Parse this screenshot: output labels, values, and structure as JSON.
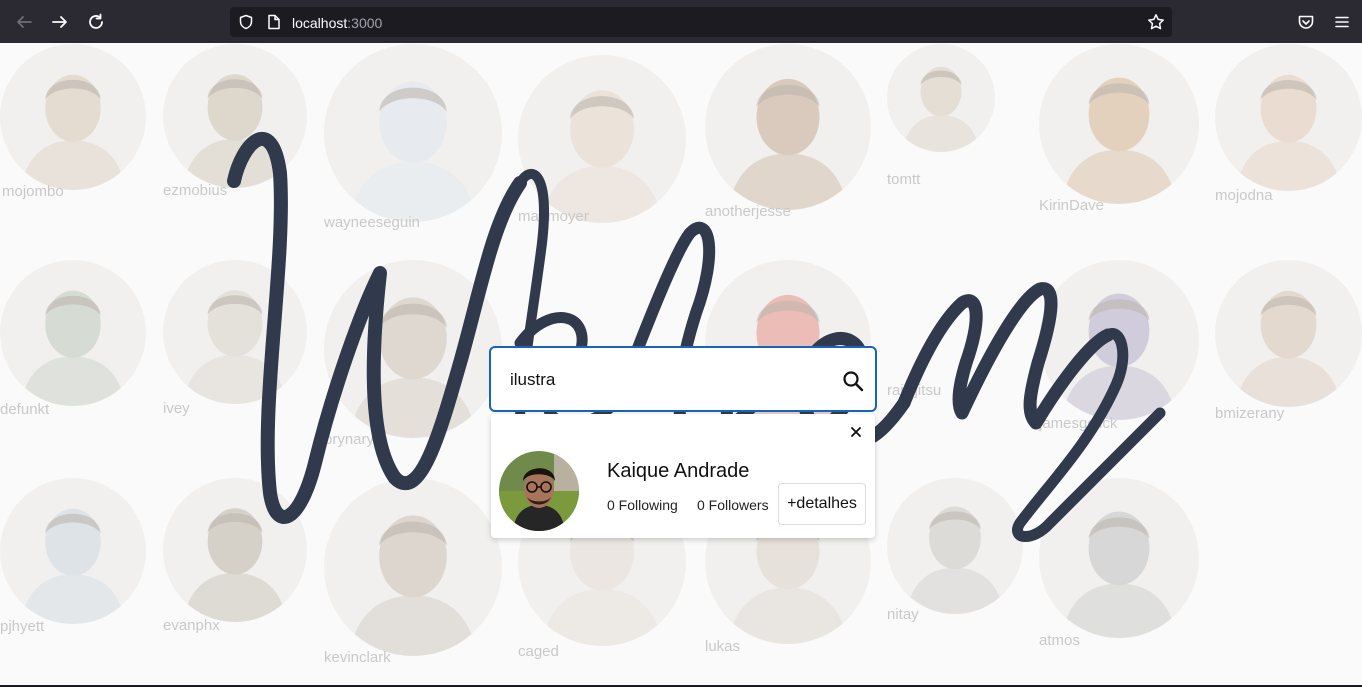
{
  "browser": {
    "url_host": "localhost",
    "url_port": ":3000"
  },
  "welcome_text": "Welcome",
  "users": [
    {
      "name": "mojombo",
      "color": "#c9b49a"
    },
    {
      "name": "ezmobius",
      "color": "#b7a88e"
    },
    {
      "name": "wayneeseguin",
      "color": "#cfd8e2"
    },
    {
      "name": "mattmoyer",
      "color": "#d8c2b0"
    },
    {
      "name": "anotherjesse",
      "color": "#b08a6a"
    },
    {
      "name": "tomtt",
      "color": "#c7b8a4"
    },
    {
      "name": "KirinDave",
      "color": "#c49a6c"
    },
    {
      "name": "mojodna",
      "color": "#d6b59a"
    },
    {
      "name": "defunkt",
      "color": "#a6b3a0"
    },
    {
      "name": "ivey",
      "color": "#c6bdb0"
    },
    {
      "name": "brynary",
      "color": "#b9aa98"
    },
    {
      "name": "railsjitsu",
      "color": "#d96b5c"
    },
    {
      "name": "jamesgolick",
      "color": "#9a8fb4"
    },
    {
      "name": "bmizerany",
      "color": "#c8ad96"
    },
    {
      "name": "pjhyett",
      "color": "#b9c4d0"
    },
    {
      "name": "evanphx",
      "color": "#a49a86"
    },
    {
      "name": "kevinclark",
      "color": "#b3a596"
    },
    {
      "name": "caged",
      "color": "#d8ccc0"
    },
    {
      "name": "lukas",
      "color": "#ccc0b0"
    },
    {
      "name": "nitay",
      "color": "#b7b2aa"
    },
    {
      "name": "atmos",
      "color": "#a8a8a8"
    }
  ],
  "search": {
    "value": "ilustra",
    "placeholder": ""
  },
  "result": {
    "name": "Kaique Andrade",
    "following": "0 Following",
    "followers": "0 Followers",
    "details_label": "+detalhes"
  },
  "colors": {
    "accent": "#1565c0",
    "welcome": "#303a4c"
  }
}
